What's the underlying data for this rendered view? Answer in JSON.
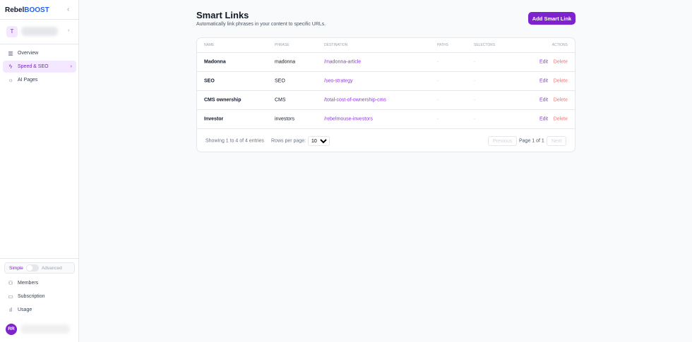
{
  "sidebar": {
    "logo_a": "Rebel",
    "logo_b": "BOOST",
    "workspace_initial": "T",
    "nav": [
      {
        "label": "Overview",
        "icon": "bar-chart-icon"
      },
      {
        "label": "Speed & SEO",
        "icon": "lightning-icon",
        "active": true
      },
      {
        "label": "AI Pages",
        "icon": "lightbulb-icon"
      }
    ],
    "mode": {
      "simple": "Simple",
      "advanced": "Advanced",
      "advanced_on": false
    },
    "bottom": [
      {
        "label": "Members",
        "icon": "users-icon"
      },
      {
        "label": "Subscription",
        "icon": "credit-card-icon"
      },
      {
        "label": "Usage",
        "icon": "bar-chart-icon"
      }
    ],
    "user_initials": "RR"
  },
  "page": {
    "title": "Smart Links",
    "subtitle": "Automatically link phrases in your content to specific URLs.",
    "add_button": "Add Smart Link"
  },
  "table": {
    "headers": [
      "Name",
      "Phrase",
      "Destination",
      "Paths",
      "Selectors",
      "Actions"
    ],
    "rows": [
      {
        "name": "Madonna",
        "phrase": "madonna",
        "destination": "/madonna-article",
        "paths": "-",
        "selectors": "-"
      },
      {
        "name": "SEO",
        "phrase": "SEO",
        "destination": "/seo-strategy",
        "paths": "-",
        "selectors": "-"
      },
      {
        "name": "CMS ownership",
        "phrase": "CMS",
        "destination": "/total-cost-of-ownership-cms",
        "paths": "-",
        "selectors": "-"
      },
      {
        "name": "Investor",
        "phrase": "investors",
        "destination": "/rebelmouse-investors",
        "paths": "-",
        "selectors": "-"
      }
    ],
    "edit": "Edit",
    "delete": "Delete"
  },
  "footer": {
    "showing": "Showing 1 to 4 of 4 entries",
    "rows_label": "Rows per page:",
    "rows_value": "10",
    "previous": "Previous",
    "page_info": "Page 1 of 1",
    "next": "Next"
  }
}
